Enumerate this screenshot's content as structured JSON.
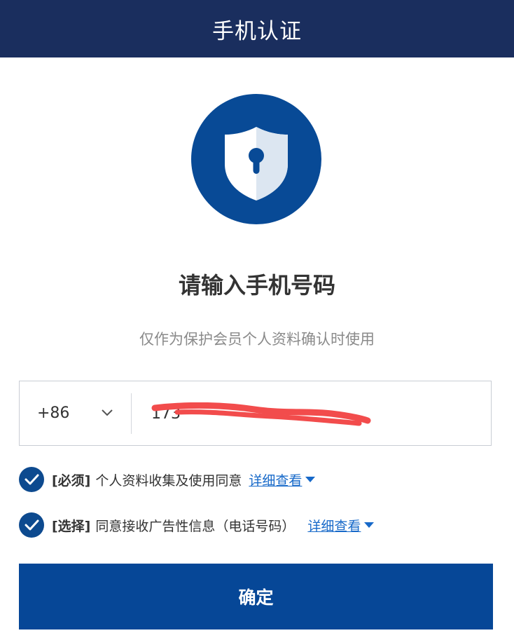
{
  "header": {
    "title": "手机认证"
  },
  "icons": {
    "badge": "shield-keyhole-icon",
    "chevron": "chevron-down-icon",
    "check": "checkmark-icon",
    "caret": "caret-down-icon"
  },
  "main": {
    "title": "请输入手机号码",
    "subtitle": "仅作为保护会员个人资料确认时使用"
  },
  "phone": {
    "country_code": "+86",
    "value": "173"
  },
  "consents": [
    {
      "tag": "[必须]",
      "text": "个人资料收集及使用同意",
      "link": "详细查看",
      "checked": true
    },
    {
      "tag": "[选择]",
      "text": "同意接收广告性信息（电话号码）",
      "link": "详细查看",
      "checked": true
    }
  ],
  "confirm": {
    "label": "确定"
  },
  "colors": {
    "header_bg": "#1a2e5e",
    "brand": "#084a96",
    "link": "#1769c9",
    "redaction": "#f24c4c"
  }
}
